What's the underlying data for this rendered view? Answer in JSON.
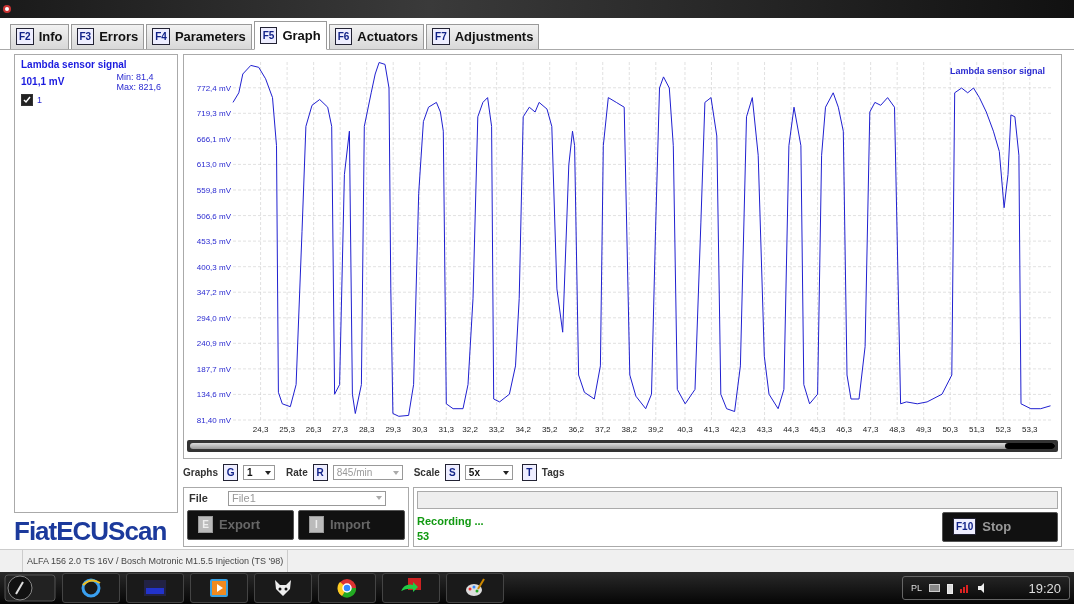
{
  "tabs": [
    {
      "key": "F2",
      "label": "Info",
      "selected": false
    },
    {
      "key": "F3",
      "label": "Errors",
      "selected": false
    },
    {
      "key": "F4",
      "label": "Parameters",
      "selected": false
    },
    {
      "key": "F5",
      "label": "Graph",
      "selected": true
    },
    {
      "key": "F6",
      "label": "Actuators",
      "selected": false
    },
    {
      "key": "F7",
      "label": "Adjustments",
      "selected": false
    }
  ],
  "sensor_panel": {
    "title": "Lambda sensor signal",
    "value": "101,1 mV",
    "min": "Min: 81,4",
    "max": "Max: 821,6",
    "channels": [
      {
        "label": "1",
        "checked": true
      }
    ]
  },
  "logo": "FiatECUScan",
  "graph": {
    "chart_data": {
      "type": "line",
      "title": "Lambda sensor signal",
      "grid": true,
      "xlim": [
        23.26,
        54.1
      ],
      "ylim": [
        81.4,
        826
      ],
      "xticks": [
        {
          "value": 24.3,
          "label": "24,3"
        },
        {
          "value": 25.3,
          "label": "25,3"
        },
        {
          "value": 26.3,
          "label": "26,3"
        },
        {
          "value": 27.3,
          "label": "27,3"
        },
        {
          "value": 28.3,
          "label": "28,3"
        },
        {
          "value": 29.3,
          "label": "29,3"
        },
        {
          "value": 30.3,
          "label": "30,3"
        },
        {
          "value": 31.3,
          "label": "31,3"
        },
        {
          "value": 32.2,
          "label": "32,2"
        },
        {
          "value": 33.2,
          "label": "33,2"
        },
        {
          "value": 34.2,
          "label": "34,2"
        },
        {
          "value": 35.2,
          "label": "35,2"
        },
        {
          "value": 36.2,
          "label": "36,2"
        },
        {
          "value": 37.2,
          "label": "37,2"
        },
        {
          "value": 38.2,
          "label": "38,2"
        },
        {
          "value": 39.2,
          "label": "39,2"
        },
        {
          "value": 40.3,
          "label": "40,3"
        },
        {
          "value": 41.3,
          "label": "41,3"
        },
        {
          "value": 42.3,
          "label": "42,3"
        },
        {
          "value": 43.3,
          "label": "43,3"
        },
        {
          "value": 44.3,
          "label": "44,3"
        },
        {
          "value": 45.3,
          "label": "45,3"
        },
        {
          "value": 46.3,
          "label": "46,3"
        },
        {
          "value": 47.3,
          "label": "47,3"
        },
        {
          "value": 48.3,
          "label": "48,3"
        },
        {
          "value": 49.3,
          "label": "49,3"
        },
        {
          "value": 50.3,
          "label": "50,3"
        },
        {
          "value": 51.3,
          "label": "51,3"
        },
        {
          "value": 52.3,
          "label": "52,3"
        },
        {
          "value": 53.3,
          "label": "53,3"
        }
      ],
      "yticks": [
        {
          "value": 81.4,
          "label": "81,40 mV"
        },
        {
          "value": 134.6,
          "label": "134,6 mV"
        },
        {
          "value": 187.7,
          "label": "187,7 mV"
        },
        {
          "value": 240.9,
          "label": "240,9 mV"
        },
        {
          "value": 294.0,
          "label": "294,0 mV"
        },
        {
          "value": 347.2,
          "label": "347,2 mV"
        },
        {
          "value": 400.3,
          "label": "400,3 mV"
        },
        {
          "value": 453.5,
          "label": "453,5 mV"
        },
        {
          "value": 506.6,
          "label": "506,6 mV"
        },
        {
          "value": 559.8,
          "label": "559,8 mV"
        },
        {
          "value": 613.0,
          "label": "613,0 mV"
        },
        {
          "value": 666.1,
          "label": "666,1 mV"
        },
        {
          "value": 719.3,
          "label": "719,3 mV"
        },
        {
          "value": 772.4,
          "label": "772,4 mV"
        }
      ],
      "x": [
        23.26,
        23.48,
        23.63,
        23.93,
        24.23,
        24.49,
        24.75,
        24.9,
        24.97,
        25.12,
        25.42,
        25.64,
        25.86,
        26.01,
        26.24,
        26.53,
        26.83,
        26.98,
        27.09,
        27.28,
        27.46,
        27.65,
        27.76,
        27.87,
        28.1,
        28.21,
        28.47,
        28.62,
        28.77,
        28.99,
        29.14,
        29.21,
        29.29,
        29.51,
        29.88,
        30.07,
        30.26,
        30.44,
        30.63,
        30.93,
        31.08,
        31.19,
        31.3,
        31.56,
        31.93,
        32.12,
        32.31,
        32.49,
        32.68,
        32.86,
        33.01,
        33.09,
        33.31,
        33.68,
        33.91,
        34.05,
        34.2,
        34.43,
        34.65,
        34.8,
        35.1,
        35.28,
        35.47,
        35.69,
        35.92,
        36.06,
        36.14,
        36.29,
        36.51,
        36.88,
        37.11,
        37.22,
        37.41,
        37.71,
        38.01,
        38.22,
        38.45,
        38.82,
        39.04,
        39.19,
        39.34,
        39.49,
        39.71,
        39.86,
        40.01,
        40.31,
        40.68,
        40.9,
        41.05,
        41.28,
        41.5,
        41.65,
        41.87,
        42.17,
        42.39,
        42.62,
        42.84,
        43.06,
        43.29,
        43.47,
        43.81,
        44.03,
        44.22,
        44.41,
        44.67,
        44.78,
        45.0,
        45.3,
        45.45,
        45.6,
        45.89,
        46.08,
        46.27,
        46.41,
        46.56,
        46.86,
        47.09,
        47.27,
        47.46,
        47.68,
        47.94,
        48.2,
        48.43,
        48.65,
        49.06,
        49.43,
        49.99,
        50.36,
        50.47,
        50.73,
        50.96,
        51.18,
        51.4,
        51.66,
        51.93,
        52.15,
        52.33,
        52.48,
        52.59,
        52.74,
        52.89,
        52.97,
        53.34,
        53.71,
        54.08
      ],
      "series": [
        {
          "color": "#2020d0",
          "values": [
            742,
            762,
            801,
            819,
            815,
            791,
            752,
            652,
            139,
            115,
            109,
            155,
            473,
            692,
            736,
            748,
            732,
            692,
            135,
            155,
            592,
            682,
            135,
            95,
            155,
            692,
            762,
            801,
            825,
            821,
            772,
            354,
            95,
            89,
            91,
            155,
            553,
            702,
            732,
            742,
            722,
            682,
            115,
            105,
            105,
            155,
            334,
            712,
            742,
            752,
            692,
            125,
            119,
            135,
            194,
            334,
            712,
            732,
            722,
            742,
            728,
            692,
            354,
            264,
            612,
            682,
            652,
            175,
            139,
            125,
            194,
            652,
            752,
            742,
            732,
            175,
            131,
            105,
            135,
            473,
            772,
            795,
            772,
            652,
            145,
            115,
            145,
            493,
            742,
            752,
            672,
            135,
            105,
            99,
            194,
            712,
            752,
            632,
            214,
            135,
            105,
            145,
            652,
            732,
            652,
            155,
            115,
            135,
            632,
            732,
            762,
            732,
            682,
            175,
            125,
            125,
            234,
            722,
            742,
            736,
            752,
            732,
            115,
            119,
            115,
            119,
            135,
            175,
            762,
            772,
            762,
            772,
            752,
            722,
            682,
            640,
            523,
            592,
            716,
            712,
            632,
            115,
            105,
            105,
            111
          ]
        }
      ]
    }
  },
  "controls": [
    {
      "kind": "select",
      "label": "Graphs",
      "key": "G",
      "value": "1",
      "disabled": false
    },
    {
      "kind": "select",
      "label": "Rate",
      "key": "R",
      "value": "845/min",
      "disabled": true
    },
    {
      "kind": "select",
      "label": "Scale",
      "key": "S",
      "value": "5x",
      "disabled": false
    },
    {
      "kind": "toggle",
      "label": "Tags",
      "key": "T"
    }
  ],
  "file_panel": {
    "label": "File",
    "value": "File1",
    "buttons": [
      {
        "key": "E",
        "label": "Export",
        "disabled": true
      },
      {
        "key": "I",
        "label": "Import",
        "disabled": true
      }
    ]
  },
  "recording": {
    "progress": {
      "level": 0
    },
    "status": "Recording ...",
    "count": "53",
    "button": {
      "key": "F10",
      "label": "Stop",
      "disabled": false
    }
  },
  "status_bar": {
    "text": "ALFA 156 2.0 TS 16V / Bosch Motronic M1.5.5 Injection (TS '98)"
  },
  "tray": {
    "language": "PL",
    "time": "19:20"
  }
}
